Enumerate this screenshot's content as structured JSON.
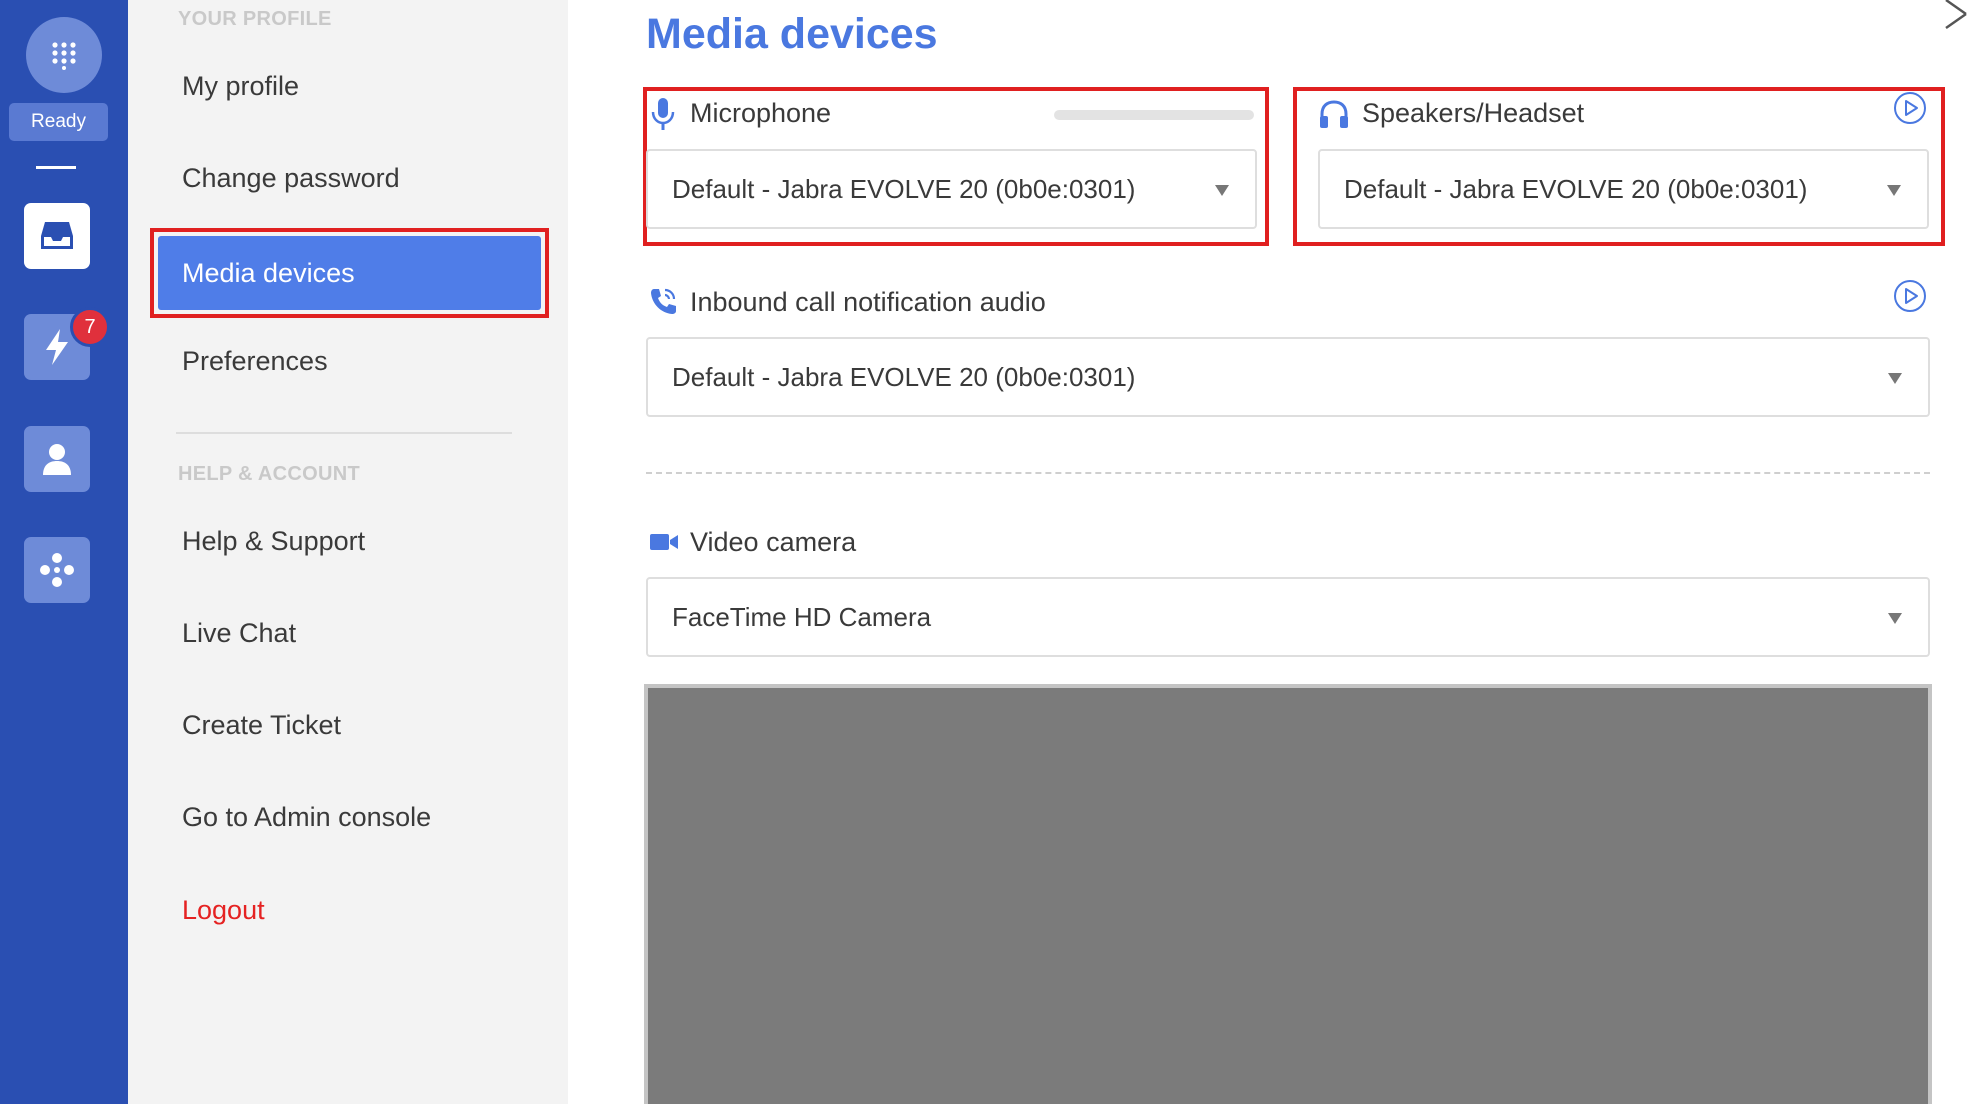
{
  "rail": {
    "status_label": "Ready",
    "badge_count": "7",
    "icons": [
      "dialpad-icon",
      "inbox-icon",
      "lightning-icon",
      "contact-icon",
      "integrations-icon"
    ],
    "colors": {
      "rail_bg": "#2a4fb2",
      "button_bg": "#6e8bd8",
      "badge": "#e0303c"
    }
  },
  "menu": {
    "profile_section": "YOUR PROFILE",
    "items": {
      "my_profile": "My profile",
      "change_password": "Change password",
      "media_devices": "Media devices",
      "preferences": "Preferences"
    },
    "help_section": "HELP & ACCOUNT",
    "help_items": {
      "help_support": "Help & Support",
      "live_chat": "Live Chat",
      "create_ticket": "Create Ticket",
      "admin_console": "Go to Admin console",
      "logout": "Logout"
    },
    "active_item": "Media devices",
    "colors": {
      "active_bg": "#4f7de8",
      "logout": "#e52222"
    }
  },
  "main": {
    "title": "Media devices",
    "microphone": {
      "label": "Microphone",
      "value": "Default - Jabra EVOLVE 20 (0b0e:0301)",
      "level": 0
    },
    "speakers": {
      "label": "Speakers/Headset",
      "value": "Default - Jabra EVOLVE 20 (0b0e:0301)"
    },
    "inbound": {
      "label": "Inbound call notification audio",
      "value": "Default - Jabra EVOLVE 20 (0b0e:0301)"
    },
    "camera": {
      "label": "Video camera",
      "value": "FaceTime HD Camera"
    },
    "colors": {
      "accent": "#4a78e0",
      "highlight": "#e02020",
      "preview": "#7b7b7b"
    }
  }
}
